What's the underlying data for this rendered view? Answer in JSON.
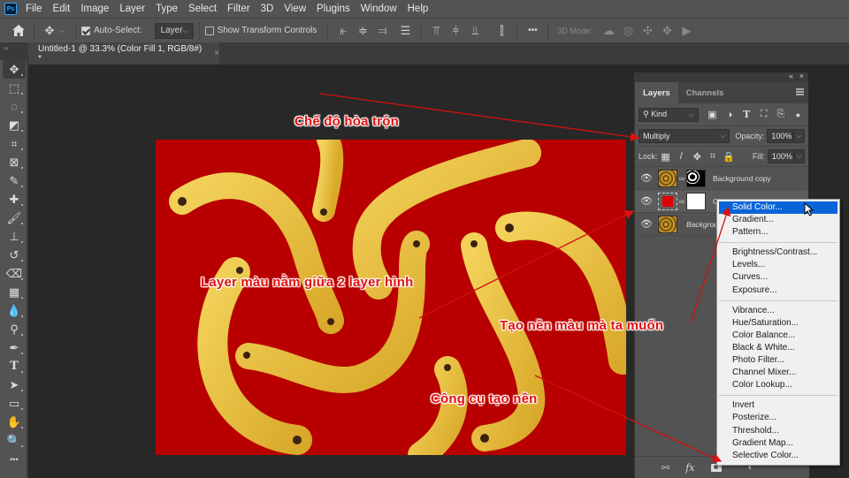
{
  "app": {
    "logo": "Ps",
    "menu": [
      "File",
      "Edit",
      "Image",
      "Layer",
      "Type",
      "Select",
      "Filter",
      "3D",
      "View",
      "Plugins",
      "Window",
      "Help"
    ]
  },
  "options_bar": {
    "home_icon": "home-icon",
    "move_icon": "move-icon",
    "auto_select_label": "Auto-Select:",
    "auto_select_checked": true,
    "auto_select_target": "Layer",
    "show_transform_label": "Show Transform Controls",
    "show_transform_checked": false,
    "more_label": "•••",
    "mode_3d_label": "3D Mode:"
  },
  "document_tab": {
    "title": "Untitled-1 @ 33.3% (Color Fill 1, RGB/8#) *",
    "close": "×"
  },
  "tools": [
    {
      "name": "move-tool",
      "glyph": "✥"
    },
    {
      "name": "marquee-tool",
      "glyph": "⬚"
    },
    {
      "name": "lasso-tool",
      "glyph": "◌"
    },
    {
      "name": "object-select-tool",
      "glyph": "◩"
    },
    {
      "name": "crop-tool",
      "glyph": "⌗"
    },
    {
      "name": "frame-tool",
      "glyph": "⊠"
    },
    {
      "name": "eyedropper-tool",
      "glyph": "✎"
    },
    {
      "name": "healing-brush-tool",
      "glyph": "✚"
    },
    {
      "name": "brush-tool",
      "glyph": "🖌"
    },
    {
      "name": "clone-stamp-tool",
      "glyph": "⊥"
    },
    {
      "name": "history-brush-tool",
      "glyph": "↺"
    },
    {
      "name": "eraser-tool",
      "glyph": "⌫"
    },
    {
      "name": "gradient-tool",
      "glyph": "▦"
    },
    {
      "name": "blur-tool",
      "glyph": "💧"
    },
    {
      "name": "dodge-tool",
      "glyph": "⚲"
    },
    {
      "name": "pen-tool",
      "glyph": "✒"
    },
    {
      "name": "type-tool",
      "glyph": "T"
    },
    {
      "name": "path-selection-tool",
      "glyph": "➤"
    },
    {
      "name": "rectangle-tool",
      "glyph": "▭"
    },
    {
      "name": "hand-tool",
      "glyph": "✋"
    },
    {
      "name": "zoom-tool",
      "glyph": "🔍"
    },
    {
      "name": "more-tools",
      "glyph": "•••"
    }
  ],
  "layers_panel": {
    "tabs": [
      "Layers",
      "Channels"
    ],
    "active_tab": "Layers",
    "filter_kind": "Kind",
    "blend_mode": "Multiply",
    "opacity_label": "Opacity:",
    "opacity": "100%",
    "lock_label": "Lock:",
    "fill_label": "Fill:",
    "fill": "100%",
    "layers": [
      {
        "name": "Background copy",
        "visible": true
      },
      {
        "name": "Color Fill 1",
        "visible": true,
        "fill_color": "#e00000"
      },
      {
        "name": "Background",
        "visible": true
      }
    ],
    "bottom_icons": [
      "link-icon",
      "fx-icon",
      "mask-icon",
      "adjustment-layer-icon"
    ]
  },
  "context_menu": {
    "groups": [
      [
        "Solid Color...",
        "Gradient...",
        "Pattern..."
      ],
      [
        "Brightness/Contrast...",
        "Levels...",
        "Curves...",
        "Exposure..."
      ],
      [
        "Vibrance...",
        "Hue/Saturation...",
        "Color Balance...",
        "Black & White...",
        "Photo Filter...",
        "Channel Mixer...",
        "Color Lookup..."
      ],
      [
        "Invert",
        "Posterize...",
        "Threshold...",
        "Gradient Map...",
        "Selective Color..."
      ]
    ],
    "highlighted": "Solid Color..."
  },
  "annotations": {
    "blend_mode": "Chế độ hòa trộn",
    "layer_between": "Layer màu nằm giữa 2 layer hình",
    "create_color": "Tạo nền màu mà ta muốn",
    "fill_tool": "Công cụ tạo nền",
    "color": "#e01010"
  },
  "canvas": {
    "background_color": "#b50000",
    "content": "bananas on red background"
  }
}
